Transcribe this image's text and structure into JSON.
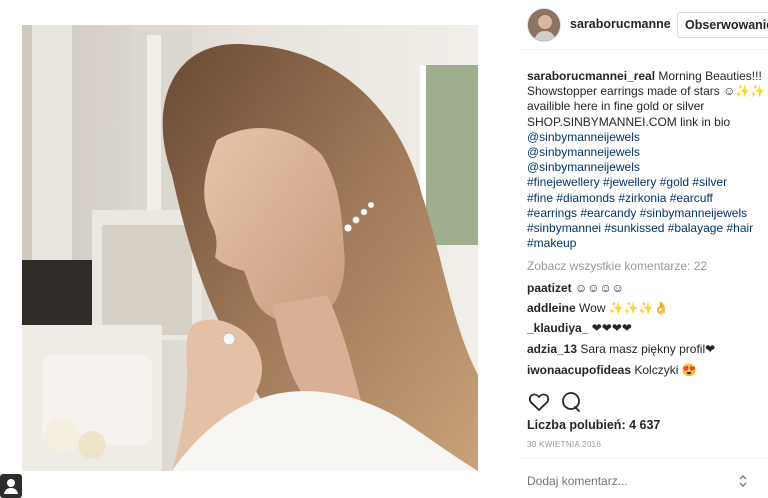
{
  "header": {
    "username": "saraborucmanne",
    "follow_label": "Obserwowanie"
  },
  "caption": {
    "username": "saraborucmannei_real",
    "lines": [
      "Morning Beauties!!!",
      "Showstopper earrings made of stars ☺✨✨",
      "availible here in fine gold or silver",
      "SHOP.SINBYMANNEI.COM link in bio",
      "@sinbymanneijewels",
      "@sinbymanneijewels",
      "@sinbymanneijewels",
      "#finejewellery #jewellery #gold #silver",
      "#fine #diamonds #zirkonia #earcuff",
      "#earrings #earcandy #sinbymanneijewels",
      "#sinbymannei #sunkissed #balayage #hair",
      "#makeup"
    ]
  },
  "view_all_comments": "Zobacz wszystkie komentarze: 22",
  "comments": [
    {
      "user": "paatizet",
      "text": "☺☺☺☺"
    },
    {
      "user": "addleine",
      "text": "Wow ✨✨✨👌"
    },
    {
      "user": "_klaudiya_",
      "text": "❤❤❤❤"
    },
    {
      "user": "adzia_13",
      "text": "Sara masz piękny profil❤"
    },
    {
      "user": "iwonaacupofideas",
      "text": "Kolczyki 😍"
    }
  ],
  "likes": "Liczba polubień: 4 637",
  "date": "30 KWIETNIA 2016",
  "comment_placeholder": "Dodaj komentarz...",
  "icons": {
    "like": "heart-icon",
    "comment": "comment-icon",
    "more": "more-options-icon",
    "corner": "user-icon"
  }
}
